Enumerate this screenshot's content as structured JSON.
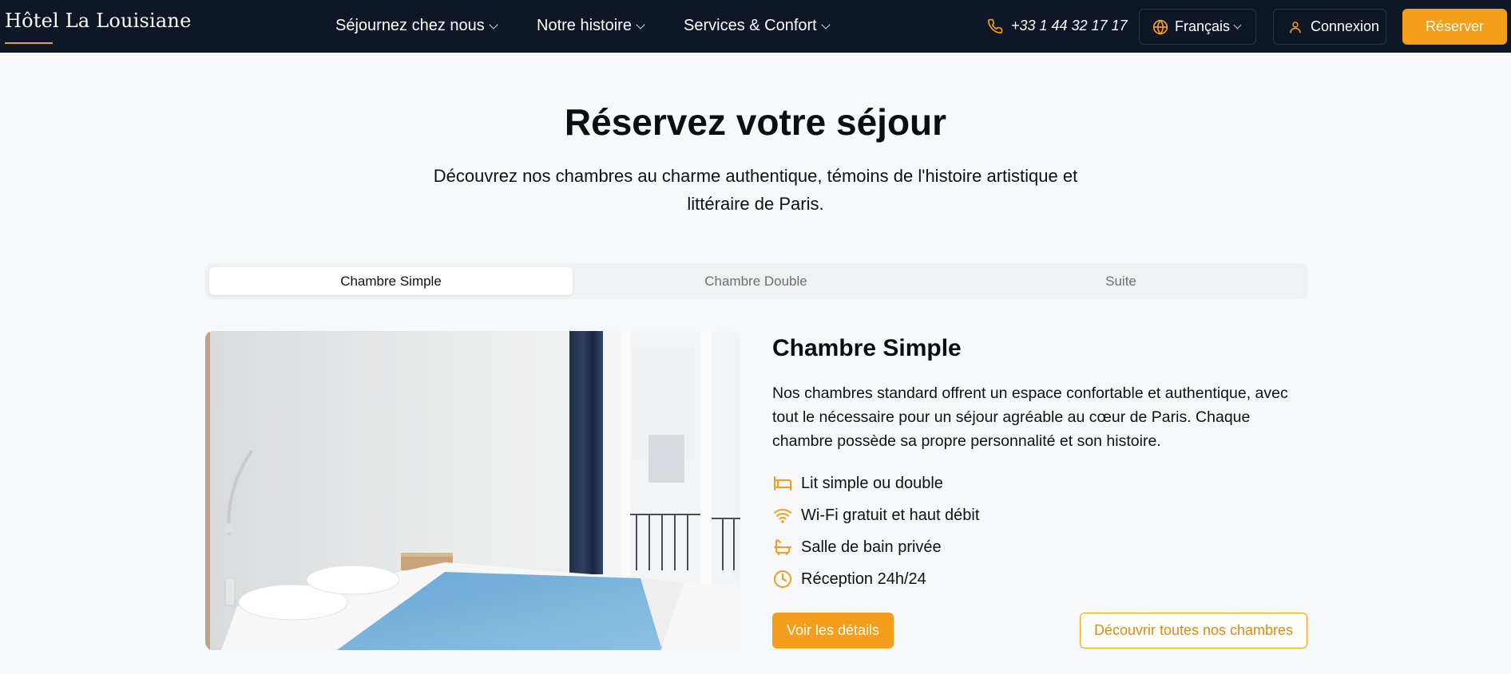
{
  "header": {
    "brand": "Hôtel La Louisiane",
    "menu": [
      {
        "label": "Séjournez chez nous"
      },
      {
        "label": "Notre histoire"
      },
      {
        "label": "Services & Confort"
      }
    ],
    "phone": "+33 1 44 32 17 17",
    "language": "Français",
    "login_label": "Connexion",
    "reserve_label": "Réserver"
  },
  "hero": {
    "title": "Réservez votre séjour",
    "subtitle": "Découvrez nos chambres au charme authentique, témoins de l'histoire artistique et littéraire de Paris."
  },
  "tabs": [
    {
      "label": "Chambre Simple",
      "active": true
    },
    {
      "label": "Chambre Double",
      "active": false
    },
    {
      "label": "Suite",
      "active": false
    }
  ],
  "room": {
    "title": "Chambre Simple",
    "description": "Nos chambres standard offrent un espace confortable et authentique, avec tout le nécessaire pour un séjour agréable au cœur de Paris. Chaque chambre possède sa propre personnalité et son histoire.",
    "features": [
      {
        "icon": "bed-icon",
        "label": "Lit simple ou double"
      },
      {
        "icon": "wifi-icon",
        "label": "Wi-Fi gratuit et haut débit"
      },
      {
        "icon": "bath-icon",
        "label": "Salle de bain privée"
      },
      {
        "icon": "clock-icon",
        "label": "Réception 24h/24"
      }
    ],
    "details_label": "Voir les détails",
    "all_rooms_label": "Découvrir toutes nos chambres"
  },
  "colors": {
    "navbar_bg": "#0f1626",
    "accent": "#f59e1b",
    "page_bg": "#f7f8fa"
  }
}
